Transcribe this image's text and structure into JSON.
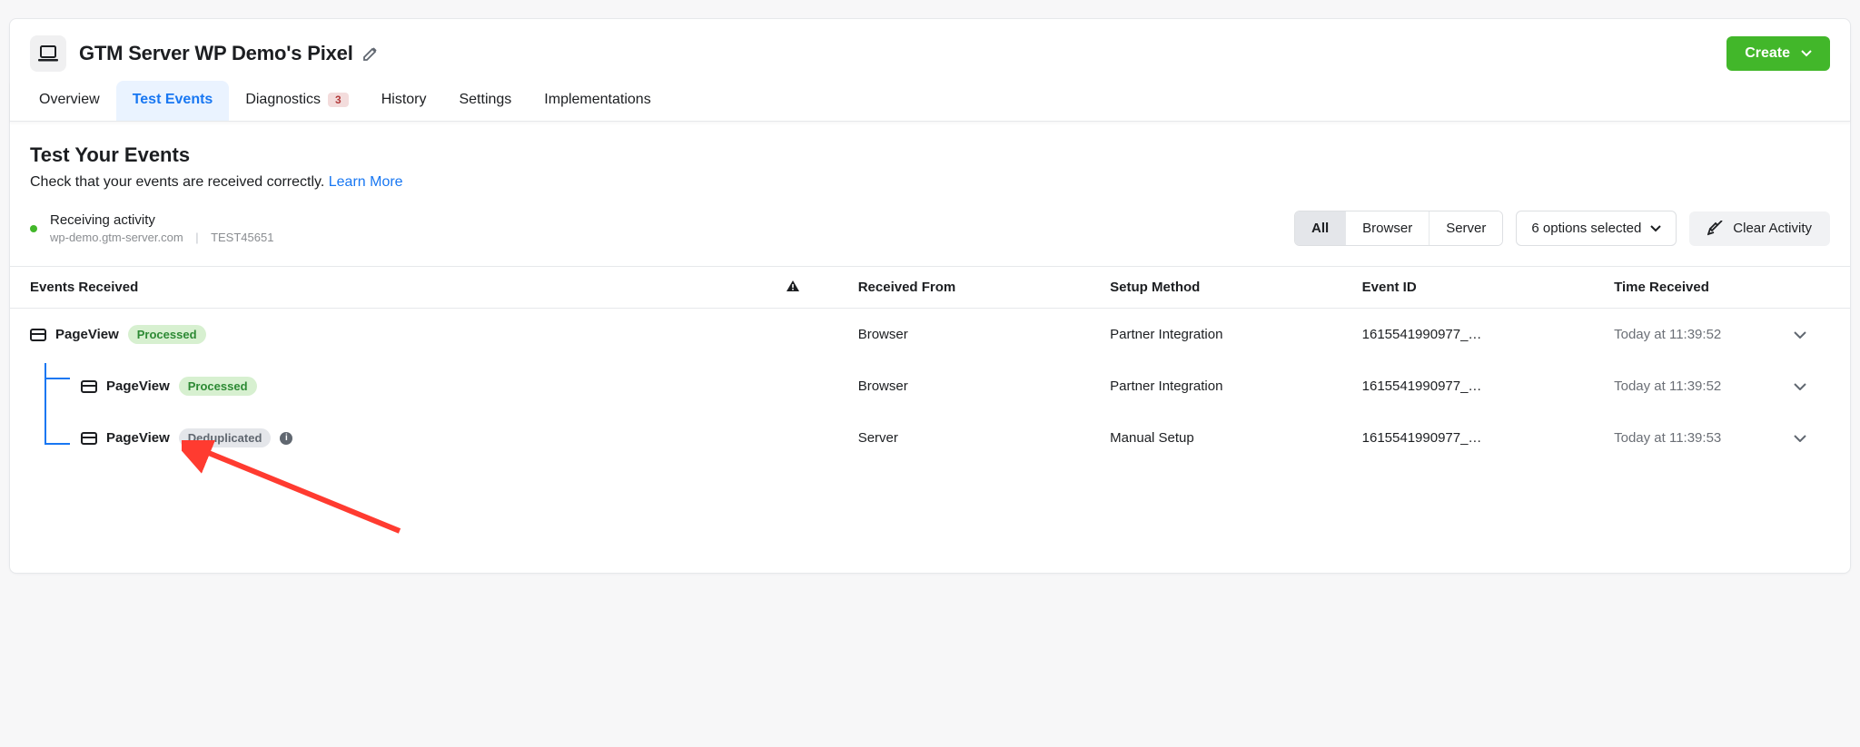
{
  "header": {
    "title": "GTM Server WP Demo's Pixel",
    "create_label": "Create"
  },
  "tabs": {
    "overview": "Overview",
    "test_events": "Test Events",
    "diagnostics": "Diagnostics",
    "diagnostics_badge": "3",
    "history": "History",
    "settings": "Settings",
    "implementations": "Implementations"
  },
  "section": {
    "title": "Test Your Events",
    "subtitle": "Check that your events are received correctly.",
    "learn_more": "Learn More"
  },
  "status": {
    "label": "Receiving activity",
    "domain": "wp-demo.gtm-server.com",
    "test_id": "TEST45651"
  },
  "filters": {
    "all": "All",
    "browser": "Browser",
    "server": "Server",
    "options_selected": "6 options selected",
    "clear": "Clear Activity"
  },
  "columns": {
    "events_received": "Events Received",
    "received_from": "Received From",
    "setup_method": "Setup Method",
    "event_id": "Event ID",
    "time_received": "Time Received"
  },
  "rows": [
    {
      "name": "PageView",
      "status": "Processed",
      "status_kind": "processed",
      "received_from": "Browser",
      "setup_method": "Partner Integration",
      "event_id": "1615541990977_…",
      "time": "Today at 11:39:52",
      "indent": 0
    },
    {
      "name": "PageView",
      "status": "Processed",
      "status_kind": "processed",
      "received_from": "Browser",
      "setup_method": "Partner Integration",
      "event_id": "1615541990977_…",
      "time": "Today at 11:39:52",
      "indent": 1
    },
    {
      "name": "PageView",
      "status": "Deduplicated",
      "status_kind": "dedup",
      "received_from": "Server",
      "setup_method": "Manual Setup",
      "event_id": "1615541990977_…",
      "time": "Today at 11:39:53",
      "indent": 1
    }
  ]
}
